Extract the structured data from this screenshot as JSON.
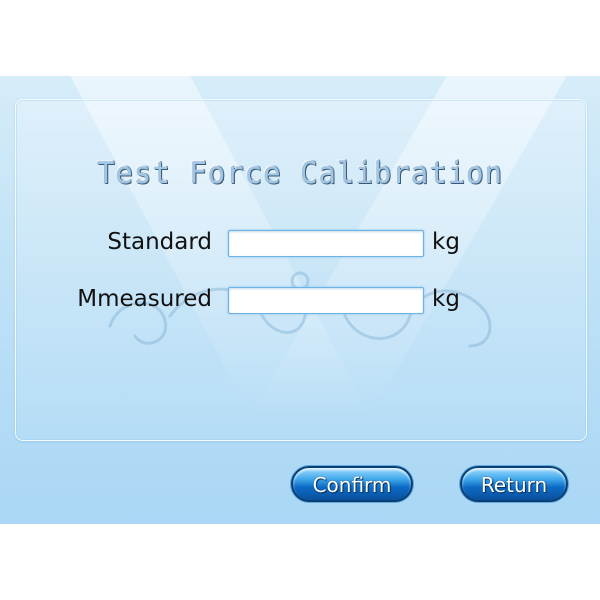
{
  "dialog": {
    "title": "Test Force Calibration",
    "rows": [
      {
        "label": "Standard",
        "value": "",
        "unit": "kg"
      },
      {
        "label": "Mmeasured",
        "value": "",
        "unit": "kg"
      }
    ]
  },
  "buttons": {
    "confirm_label": "Confirm",
    "return_label": "Return"
  },
  "colors": {
    "background_top": "#d6ecf9",
    "background_bottom": "#a9d7f5",
    "button_blue": "#0d6bc5"
  }
}
